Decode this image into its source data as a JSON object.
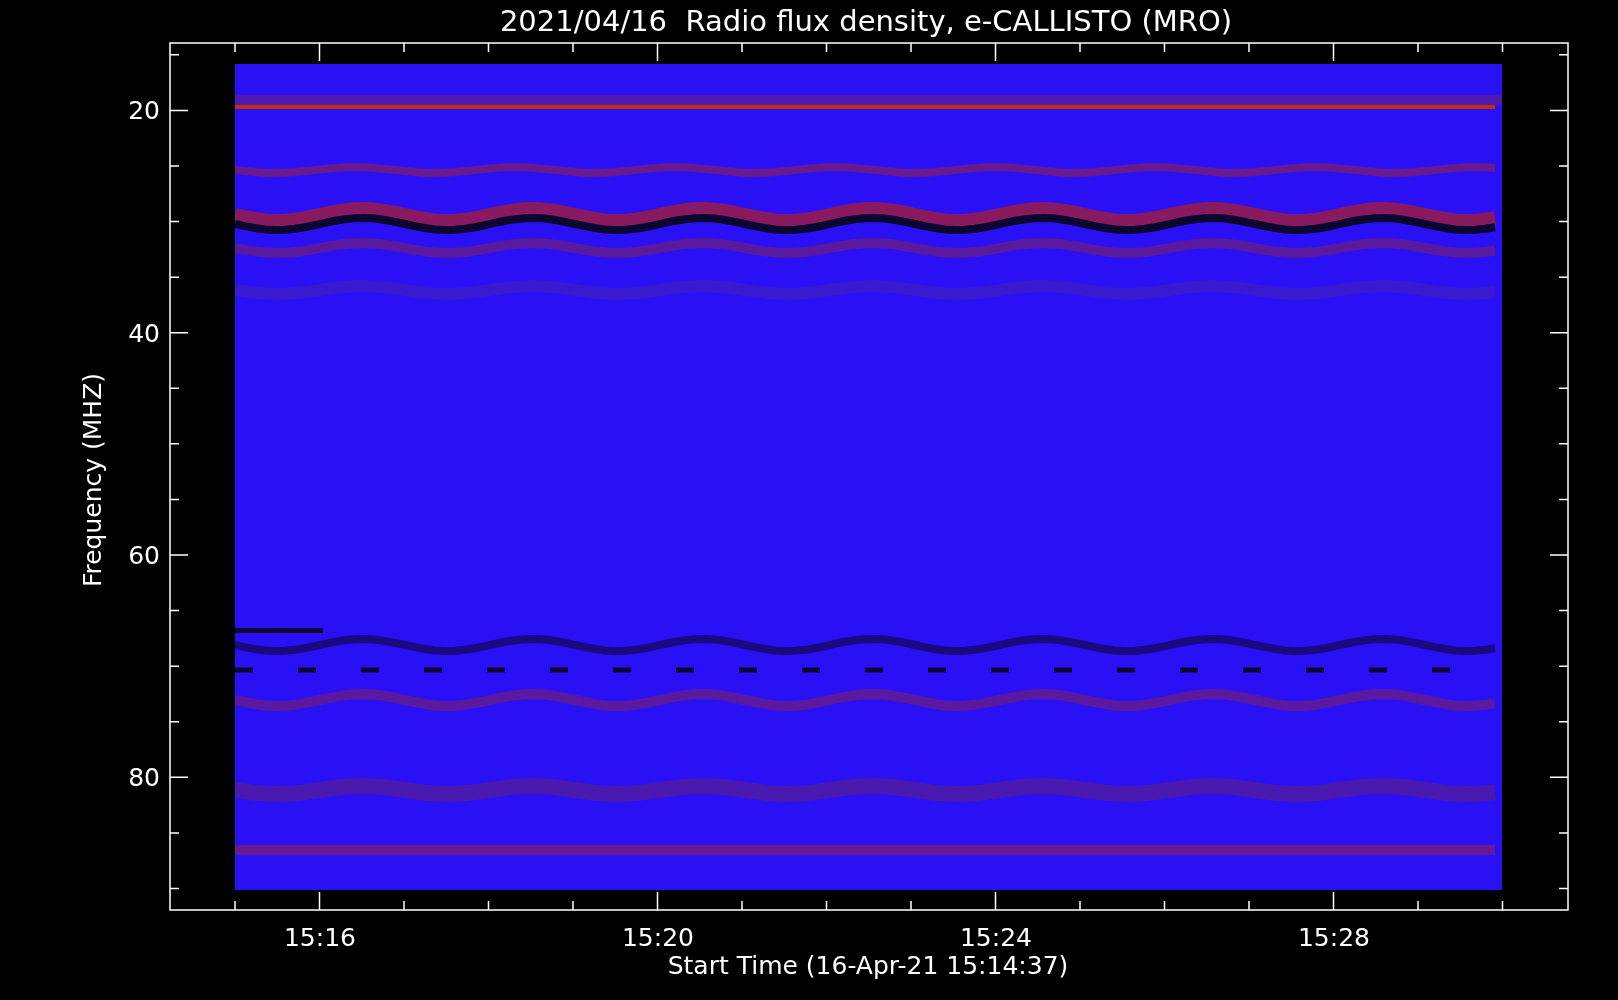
{
  "title": "2021/04/16  Radio flux density, e-CALLISTO (MRO)",
  "y_axis": {
    "label": "Frequency (MHZ)",
    "ticks": [
      "20",
      "40",
      "60",
      "80"
    ]
  },
  "x_axis": {
    "label": "Start Time (16-Apr-21 15:14:37)",
    "ticks": [
      "15:16",
      "15:20",
      "15:24",
      "15:28"
    ]
  }
}
